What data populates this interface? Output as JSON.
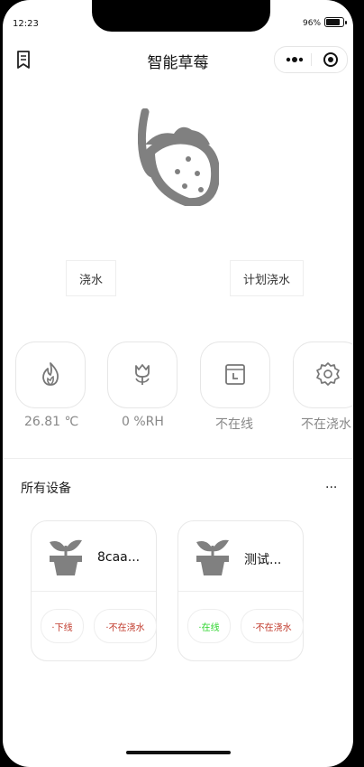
{
  "status_bar": {
    "time": "12:23",
    "battery": "96%"
  },
  "nav": {
    "title": "智能草莓",
    "bookmark_icon": "bookmark-icon",
    "more_icon": "more-dots-icon",
    "target_icon": "target-icon"
  },
  "hero": {
    "icon": "strawberry-icon"
  },
  "actions": {
    "water_label": "浇水",
    "plan_label": "计划浇水"
  },
  "stats": [
    {
      "icon": "flame-icon",
      "label": "26.81 ℃"
    },
    {
      "icon": "flower-icon",
      "label": "0 %RH"
    },
    {
      "icon": "calendar-clock-icon",
      "label": "不在线"
    },
    {
      "icon": "gear-icon",
      "label": "不在浇水"
    }
  ],
  "devices": {
    "title": "所有设备",
    "more": "...",
    "items": [
      {
        "name": "8caa...",
        "icon": "plant-pot-icon",
        "online_label": "·下线",
        "online_color": "#c0392b",
        "water_label": "·不在浇水",
        "water_color": "#c0392b"
      },
      {
        "name": "测试...",
        "icon": "plant-pot-icon",
        "online_label": "·在线",
        "online_color": "#2bd42b",
        "water_label": "·不在浇水",
        "water_color": "#c0392b"
      }
    ]
  }
}
